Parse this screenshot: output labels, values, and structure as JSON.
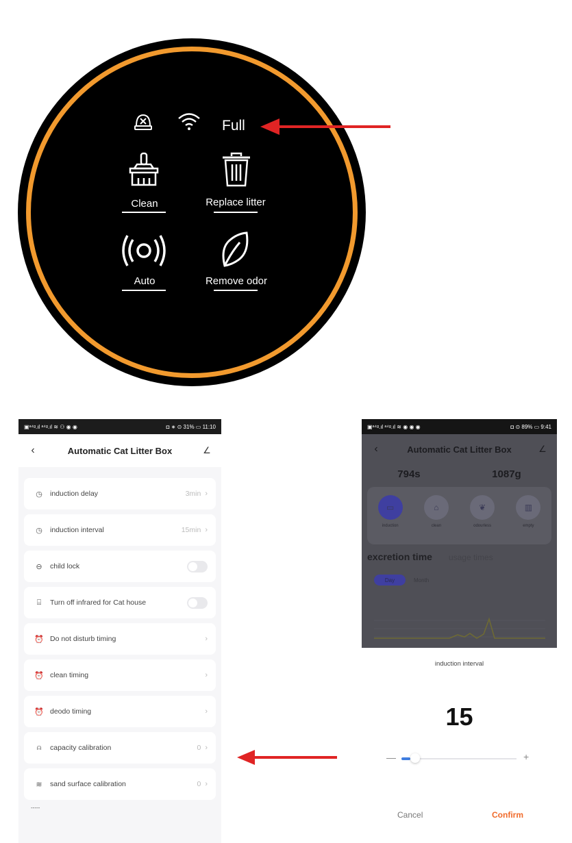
{
  "device_panel": {
    "status_text": "Full",
    "buttons": [
      {
        "label": "Clean",
        "icon": "broom-icon"
      },
      {
        "label": "Replace litter",
        "icon": "trash-icon"
      },
      {
        "label": "Auto",
        "icon": "signal-waves-icon"
      },
      {
        "label": "Remove odor",
        "icon": "leaf-icon"
      }
    ],
    "status_icons": [
      "sensor-alert-icon",
      "wifi-icon"
    ],
    "colors": {
      "ring": "#f29a2e",
      "panel": "#000000",
      "arrow": "#e02424"
    }
  },
  "left_phone": {
    "statusbar": {
      "left": "▣ᵃ⁴ᵍ.ıl ᵃ⁴ᵍ.ıl ≋ ⚇ ◉ ◉",
      "right": "◘ ∗ ⊙ 31% ▭ 11:10"
    },
    "title": "Automatic Cat Litter Box",
    "rows": [
      {
        "icon": "clock-icon",
        "label": "induction delay",
        "value": "3min"
      },
      {
        "icon": "clock-icon",
        "label": "induction interval",
        "value": "15min"
      },
      {
        "icon": "lock-icon",
        "label": "child lock",
        "value": ""
      },
      {
        "icon": "infrared-icon",
        "label": "Turn off infrared for Cat house",
        "value": ""
      },
      {
        "icon": "alarm-icon",
        "label": "Do not disturb timing",
        "value": ""
      },
      {
        "icon": "alarm-icon",
        "label": "clean timing",
        "value": ""
      },
      {
        "icon": "alarm-icon",
        "label": "deodo timing",
        "value": ""
      },
      {
        "icon": "scale-icon",
        "label": "capacity calibration",
        "value": "0"
      },
      {
        "icon": "waves-icon",
        "label": "sand surface calibration",
        "value": "0"
      }
    ],
    "peek_text": "-----"
  },
  "right_phone": {
    "statusbar": {
      "left": "▣ᵃ⁴ᵍ.ıl ᵃ⁴ᵍ.ıl ≋ ◉ ◉ ◉",
      "right": "◘ ⊙ 89% ▭ 9:41"
    },
    "title": "Automatic Cat Litter Box",
    "stats": [
      "794s",
      "1087g"
    ],
    "modes": [
      {
        "label": "induction",
        "active": true
      },
      {
        "label": "clean",
        "active": false
      },
      {
        "label": "odourless",
        "active": false
      },
      {
        "label": "empty",
        "active": false
      }
    ],
    "tabs": {
      "active": "excretion time",
      "inactive": "usage times"
    },
    "pill_tabs": [
      "Day",
      "Month"
    ],
    "sheet": {
      "title": "induction interval",
      "value": "15",
      "slider_fraction": 0.08,
      "minus": "—",
      "plus": "+",
      "cancel": "Cancel",
      "confirm": "Confirm"
    }
  }
}
